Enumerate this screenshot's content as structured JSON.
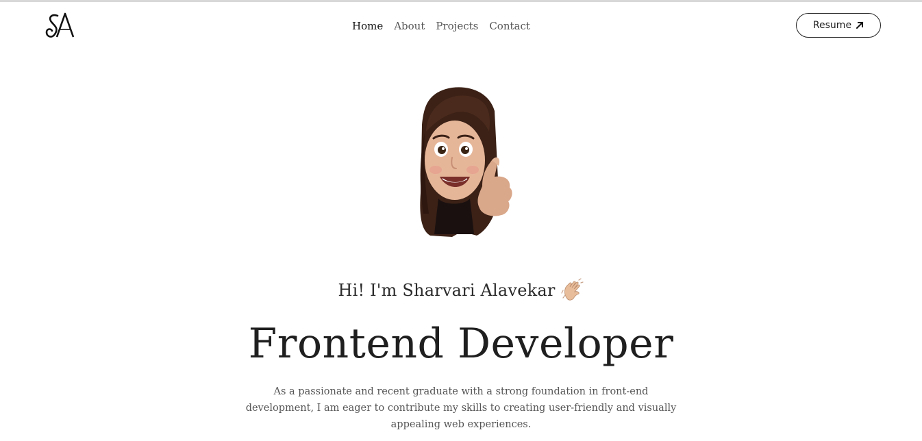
{
  "logo": {
    "text": "SA",
    "icon": "sa-monogram-logo"
  },
  "nav": {
    "items": [
      {
        "label": "Home",
        "active": true
      },
      {
        "label": "About",
        "active": false
      },
      {
        "label": "Projects",
        "active": false
      },
      {
        "label": "Contact",
        "active": false
      }
    ]
  },
  "resume": {
    "label": "Resume",
    "icon": "arrow-up-right-icon"
  },
  "hero": {
    "avatar_icon": "memoji-avatar",
    "greeting": "Hi! I'm Sharvari Alavekar",
    "greeting_icon": "waving-hand-icon",
    "headline": "Frontend Developer",
    "intro": "As a passionate and recent graduate with a strong foundation in front-end development, I am eager to contribute my skills to creating user-friendly and visually appealing web experiences."
  },
  "colors": {
    "text": "#1f1f1f",
    "muted": "#555555",
    "hair": "#4a2a1a",
    "skin": "#e8b89a",
    "background": "#ffffff"
  }
}
